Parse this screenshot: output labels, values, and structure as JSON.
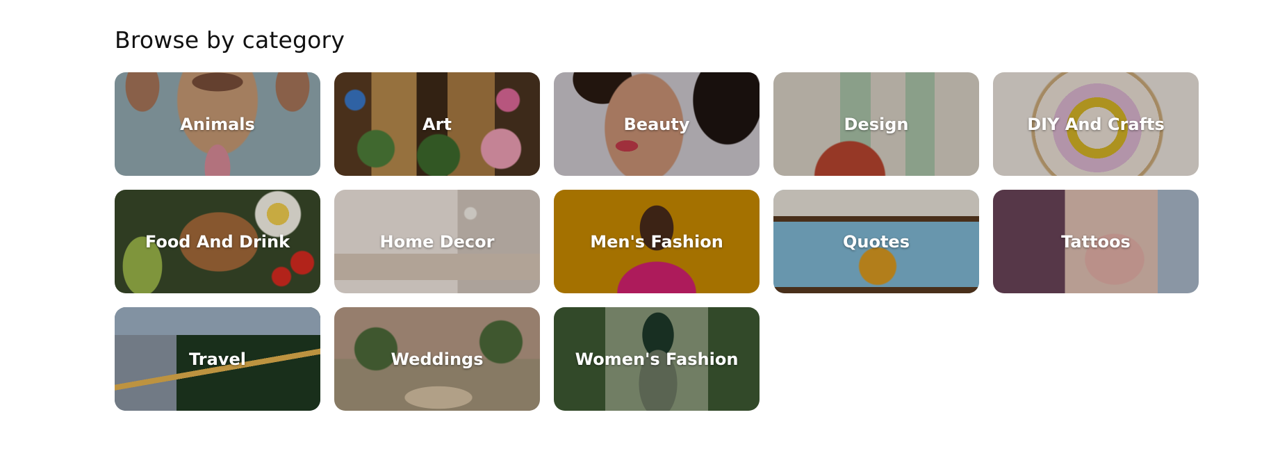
{
  "section": {
    "title": "Browse by category"
  },
  "categories": [
    {
      "label": "Animals"
    },
    {
      "label": "Art"
    },
    {
      "label": "Beauty"
    },
    {
      "label": "Design"
    },
    {
      "label": "DIY And Crafts"
    },
    {
      "label": "Food And Drink"
    },
    {
      "label": "Home Decor"
    },
    {
      "label": "Men's Fashion"
    },
    {
      "label": "Quotes"
    },
    {
      "label": "Tattoos"
    },
    {
      "label": "Travel"
    },
    {
      "label": "Weddings"
    },
    {
      "label": "Women's Fashion"
    }
  ],
  "colors": {
    "background": "#ffffff",
    "title_text": "#111111",
    "tile_label_text": "#ffffff"
  }
}
